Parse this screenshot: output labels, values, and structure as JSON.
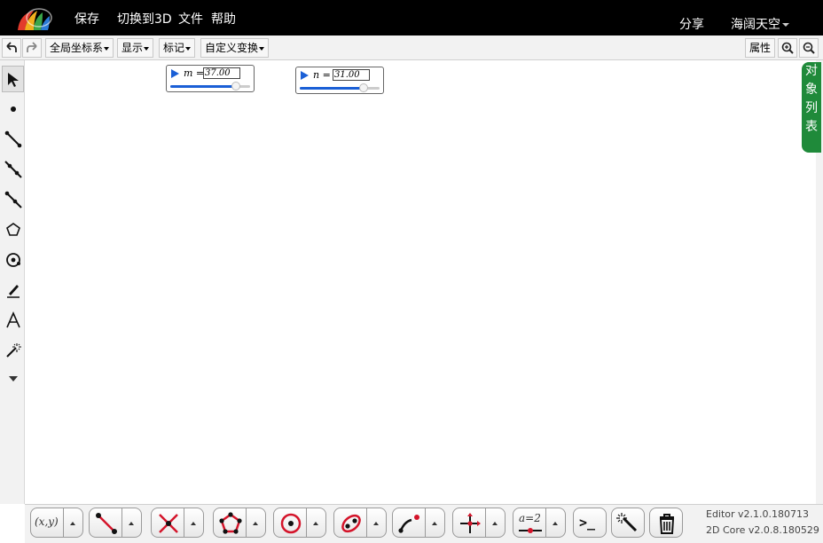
{
  "topbar": {
    "menu": [
      "保存",
      "切换到3D",
      "文件",
      "帮助"
    ],
    "share": "分享",
    "user": "海阔天空"
  },
  "toolbar": {
    "undo_icon": "undo-icon",
    "redo_icon": "redo-icon",
    "dropdowns": [
      "全局坐标系",
      "显示",
      "标记",
      "自定义变换"
    ],
    "properties": "属性",
    "zoom_in_icon": "zoom-in-icon",
    "zoom_out_icon": "zoom-out-icon"
  },
  "left_tools": [
    "select-arrow-icon",
    "point-icon",
    "segment-icon",
    "line-icon",
    "ray-icon",
    "polygon-icon",
    "circle-icon",
    "pen-icon",
    "text-icon",
    "magic-wand-icon",
    "more-down-icon"
  ],
  "sliders": [
    {
      "var": "m",
      "value": "37.00",
      "fill_fraction": 0.82
    },
    {
      "var": "n",
      "value": "31.00",
      "fill_fraction": 0.8
    }
  ],
  "object_list_tab": [
    "对",
    "象",
    "列",
    "表"
  ],
  "bottom_tools": {
    "coordinate_label": "(x,y)",
    "measure_label": "a=2",
    "console_label": ">_"
  },
  "version": {
    "editor": "Editor v2.1.0.180713",
    "core": "2D Core v2.0.8.180529"
  },
  "colors": {
    "accent_blue": "#1a5fd6",
    "tab_green": "#1f8a3a",
    "tool_red": "#d4142a"
  }
}
